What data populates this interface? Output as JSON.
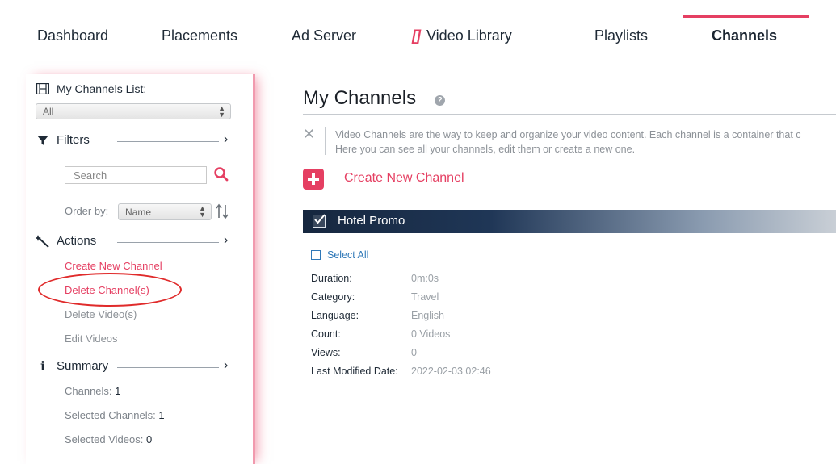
{
  "nav": {
    "dashboard": "Dashboard",
    "placements": "Placements",
    "ad_server": "Ad Server",
    "video_library_icon": "[]",
    "video_library": "Video Library",
    "playlists": "Playlists",
    "channels": "Channels"
  },
  "sidebar": {
    "channels_list_label": "My Channels List:",
    "channels_list_value": "All",
    "filters_label": "Filters",
    "search_placeholder": "Search",
    "order_by_label": "Order by:",
    "order_by_value": "Name",
    "actions_label": "Actions",
    "actions": [
      {
        "label": "Create New Channel"
      },
      {
        "label": "Delete Channel(s)"
      },
      {
        "label": "Delete Video(s)"
      },
      {
        "label": "Edit Videos"
      }
    ],
    "summary_label": "Summary",
    "summary": {
      "channels_label": "Channels:",
      "channels_value": "1",
      "selected_channels_label": "Selected Channels:",
      "selected_channels_value": "1",
      "selected_videos_label": "Selected Videos:",
      "selected_videos_value": "0"
    }
  },
  "main": {
    "title": "My Channels",
    "help_icon": "?",
    "info_close": "✕",
    "info_line1": "Video Channels are the way to keep and organize your video content. Each channel is a container that c",
    "info_line2": "Here you can see all your channels, edit them or create a new one.",
    "create_label": "Create New Channel",
    "channel": {
      "name": "Hotel Promo",
      "select_all": "Select All",
      "details": [
        {
          "label": "Duration:",
          "value": "0m:0s"
        },
        {
          "label": "Category:",
          "value": "Travel"
        },
        {
          "label": "Language:",
          "value": "English"
        },
        {
          "label": "Count:",
          "value": "0 Videos"
        },
        {
          "label": "Views:",
          "value": "0"
        },
        {
          "label": "Last Modified Date:",
          "value": "2022-02-03 02:46"
        }
      ]
    }
  },
  "colors": {
    "accent": "#e53f62",
    "annotation": "#e02b2b",
    "link": "#2f78b8",
    "header_dark": "#16273f"
  }
}
